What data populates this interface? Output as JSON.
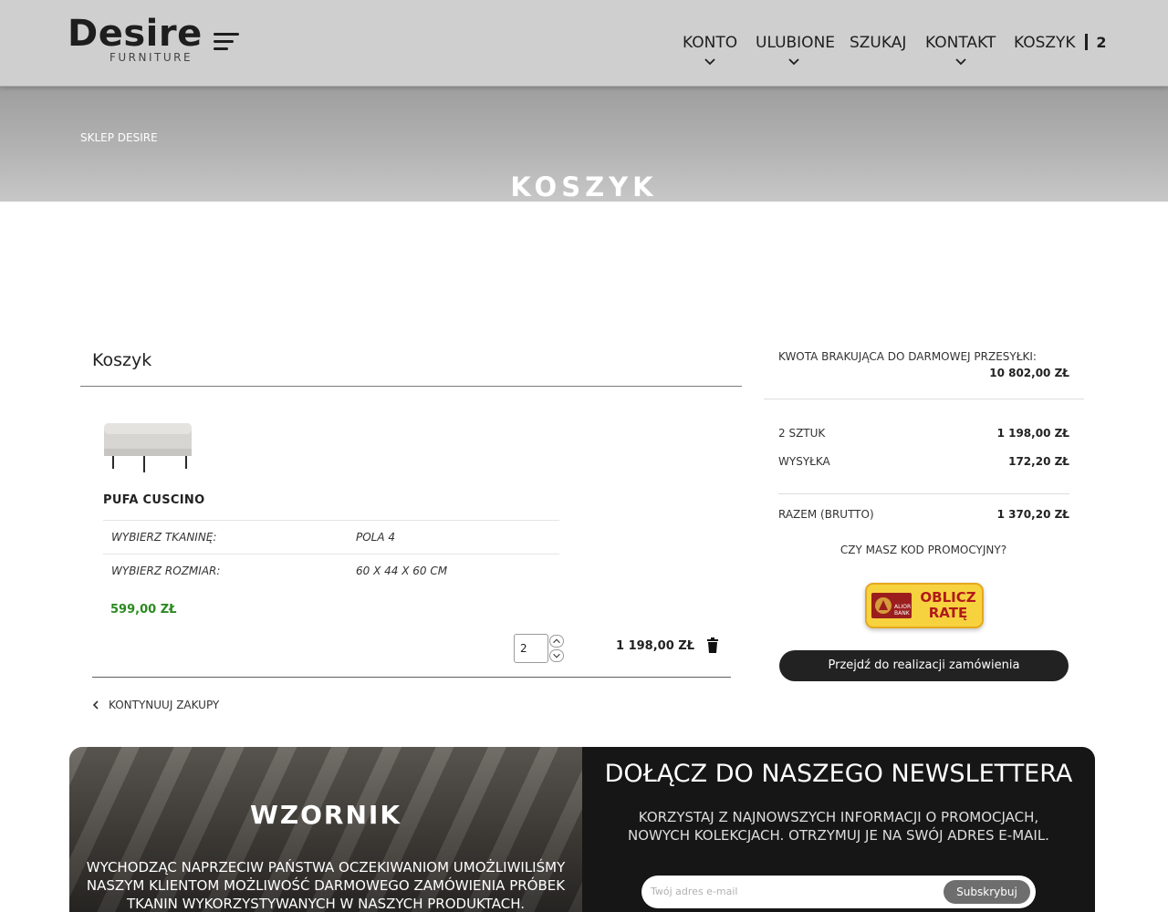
{
  "header": {
    "logo_main": "Desire",
    "logo_sub": "FURNITURE",
    "nav": {
      "konto": "KONTO",
      "ulubione": "ULUBIONE",
      "szukaj": "SZUKAJ",
      "kontakt": "KONTAKT",
      "koszyk": "KOSZYK",
      "cart_count": "2"
    }
  },
  "hero": {
    "breadcrumb": "SKLEP DESIRE",
    "title": "KOSZYK"
  },
  "cart": {
    "title": "Koszyk",
    "item": {
      "name": "PUFA CUSCINO",
      "attributes": [
        {
          "label": "WYBIERZ TKANINĘ:",
          "value": "POLA 4"
        },
        {
          "label": "WYBIERZ ROZMIAR:",
          "value": "60 X 44 X 60 CM"
        }
      ],
      "unit_price": "599,00 ZŁ",
      "quantity": "2",
      "line_total": "1 198,00 ZŁ"
    },
    "continue_label": "KONTYNUUJ ZAKUPY"
  },
  "summary": {
    "free_shipping_label": "KWOTA BRAKUJĄCA DO DARMOWEJ PRZESYŁKI:",
    "free_shipping_value": "10 802,00 ZŁ",
    "items_label": "2 SZTUK",
    "items_value": "1 198,00 ZŁ",
    "shipping_label": "WYSYŁKA",
    "shipping_value": "172,20 ZŁ",
    "total_label": "RAZEM (BRUTTO)",
    "total_value": "1 370,20 ZŁ",
    "promo_label": "CZY MASZ KOD PROMOCYJNY?",
    "raty_bank": "ALIOR BANK",
    "raty_label": "OBLICZ RATĘ",
    "checkout_label": "Przejdź do realizacji zamówienia"
  },
  "wzornik": {
    "title": "WZORNIK",
    "text": "WYCHODZĄC NAPRZECIW PAŃSTWA OCZEKIWANIOM UMOŻLIWILIŚMY NASZYM KLIENTOM MOŻLIWOŚĆ DARMOWEGO ZAMÓWIENIA PRÓBEK TKANIN WYKORZYSTYWANYCH W NASZYCH PRODUKTACH."
  },
  "newsletter": {
    "title": "DOŁĄCZ DO NASZEGO NEWSLETTERA",
    "text": "KORZYSTAJ Z NAJNOWSZYCH INFORMACJI O PROMOCJACH, NOWYCH KOLEKCJACH. OTRZYMUJ JE NA SWÓJ ADRES E-MAIL.",
    "placeholder": "Twój adres e-mail",
    "button": "Subskrybuj"
  },
  "colors": {
    "header_bg": "#cfcfcf",
    "price_green": "#2a8a1f",
    "checkout_bg": "#222222",
    "raty_yellow": "#f7d23f"
  }
}
